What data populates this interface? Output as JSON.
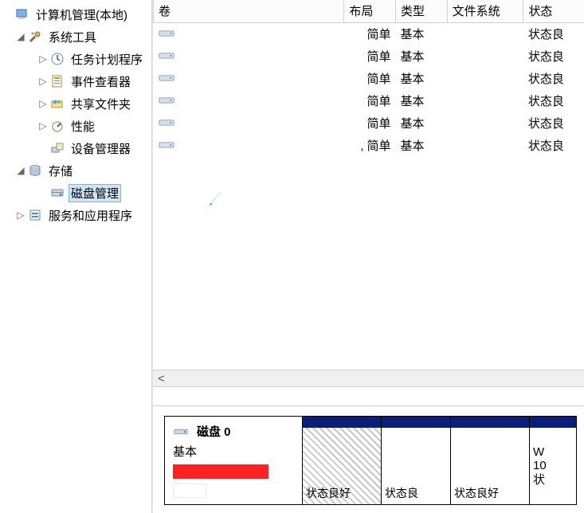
{
  "tree": {
    "root": "计算机管理(本地)",
    "systools": "系统工具",
    "tasks": "任务计划程序",
    "events": "事件查看器",
    "shares": "共享文件夹",
    "perf": "性能",
    "devmgr": "设备管理器",
    "storage": "存储",
    "diskmgmt": "磁盘管理",
    "services": "服务和应用程序"
  },
  "cols": {
    "vol": "卷",
    "layout": "布局",
    "type": "类型",
    "fs": "文件系统",
    "status": "状态"
  },
  "col_widths": [
    "200",
    "54",
    "54",
    "80",
    "64"
  ],
  "rows": [
    {
      "layout": "简单",
      "type": "基本",
      "status": "状态良"
    },
    {
      "layout": "简单",
      "type": "基本",
      "status": "状态良"
    },
    {
      "layout": "简单",
      "type": "基本",
      "status": "状态良"
    },
    {
      "layout": "简单",
      "type": "基本",
      "status": "状态良"
    },
    {
      "layout": "简单",
      "type": "基本",
      "status": "状态良"
    },
    {
      "prefix": ",",
      "layout": "简单",
      "type": "基本",
      "status": "状态良"
    }
  ],
  "scroll_left": "<",
  "disk": {
    "title": "磁盘 0",
    "type": "基本",
    "parts": [
      {
        "status": "状态良好",
        "hatched": true
      },
      {
        "status": "状态良"
      },
      {
        "status": "状态良好"
      },
      {
        "lines": [
          "W",
          "10",
          "状"
        ]
      }
    ]
  }
}
